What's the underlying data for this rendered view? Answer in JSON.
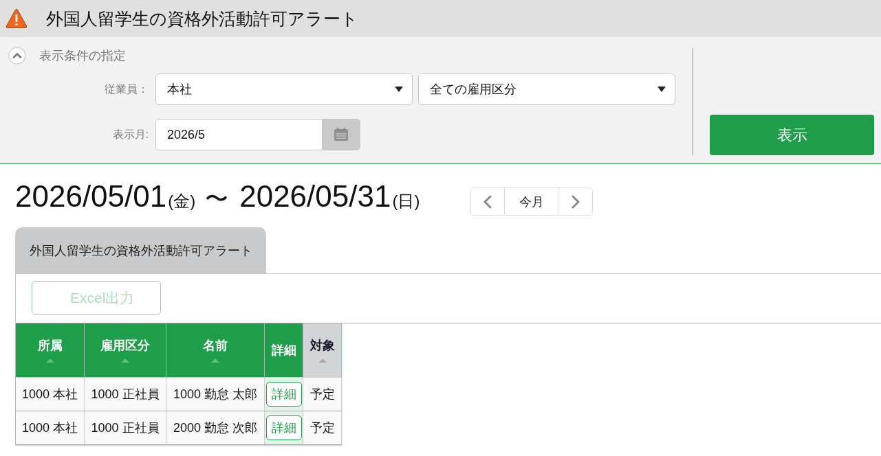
{
  "header": {
    "title": "外国人留学生の資格外活動許可アラート"
  },
  "conditions": {
    "title": "表示条件の指定",
    "expanded": true,
    "employee": {
      "label": "従業員：",
      "office": "本社",
      "employment_type": "全ての雇用区分"
    },
    "month": {
      "label": "表示月:",
      "value": "2026/5"
    },
    "submit_button": "表示"
  },
  "period": {
    "start_date": "2026/05/01",
    "start_weekday": "(金)",
    "separator": "〜",
    "end_date": "2026/05/31",
    "end_weekday": "(日)"
  },
  "month_nav": {
    "current_label": "今月"
  },
  "tabs": [
    {
      "label": "外国人留学生の資格外活動許可アラート",
      "selected": true
    }
  ],
  "export_button": {
    "label": "Excel出力",
    "disabled": true
  },
  "table": {
    "columns": [
      {
        "label": "所属",
        "kind": "text",
        "sortable": true
      },
      {
        "label": "雇用区分",
        "kind": "text",
        "sortable": true
      },
      {
        "label": "名前",
        "kind": "text",
        "sortable": true
      },
      {
        "label": "詳細",
        "kind": "action",
        "sortable": false
      },
      {
        "label": "対象",
        "kind": "status",
        "sortable": true
      }
    ],
    "rows": [
      {
        "cells": [
          "1000 本社",
          "1000 正社員",
          "1000 勤怠 太郎",
          "詳細",
          "予定"
        ]
      },
      {
        "cells": [
          "1000 本社",
          "1000 正社員",
          "2000 勤怠 次郎",
          "詳細",
          "予定"
        ]
      }
    ]
  }
}
